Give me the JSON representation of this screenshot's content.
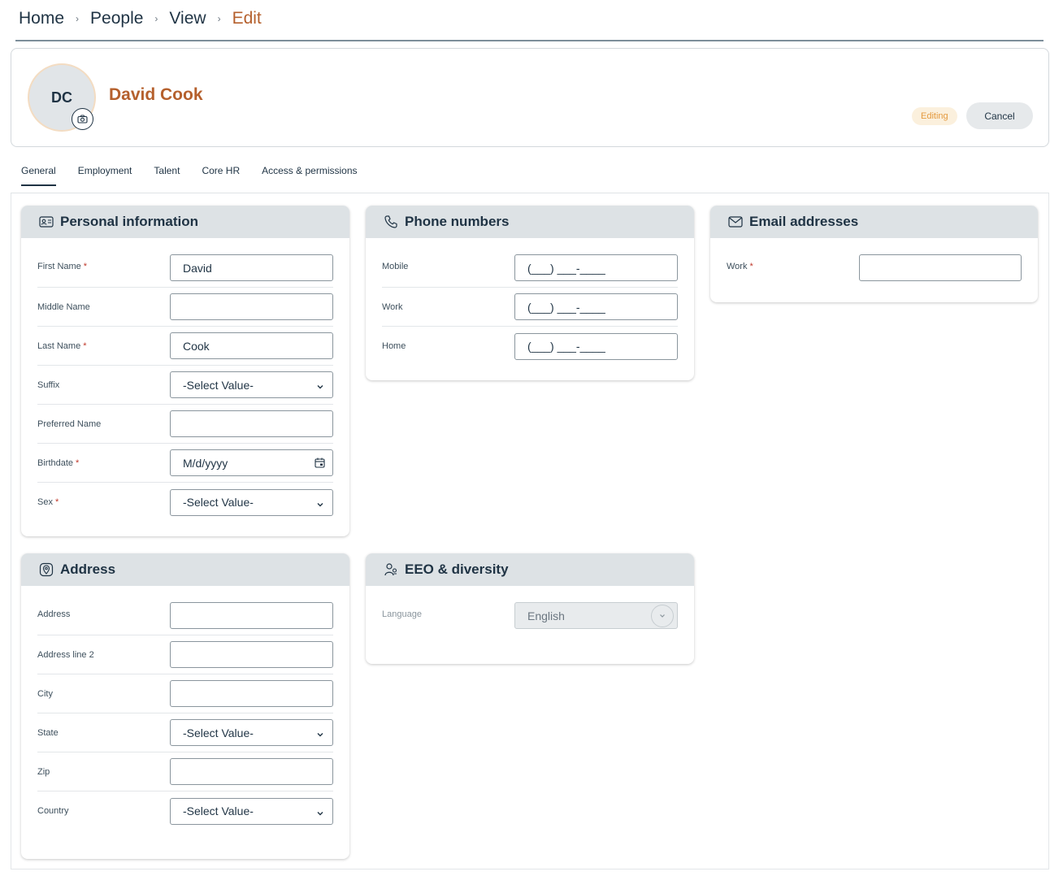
{
  "breadcrumb": {
    "items": [
      "Home",
      "People",
      "View"
    ],
    "current": "Edit",
    "separator": "›"
  },
  "profile": {
    "initials": "DC",
    "name": "David Cook",
    "status_badge": "Editing",
    "cancel_label": "Cancel"
  },
  "tabs": [
    "General",
    "Employment",
    "Talent",
    "Core HR",
    "Access & permissions"
  ],
  "active_tab": "General",
  "personal": {
    "title": "Personal information",
    "first_name": {
      "label": "First Name",
      "required": "*",
      "value": "David"
    },
    "middle_name": {
      "label": "Middle Name",
      "value": ""
    },
    "last_name": {
      "label": "Last Name",
      "required": "*",
      "value": "Cook"
    },
    "suffix": {
      "label": "Suffix",
      "value": "-Select Value-"
    },
    "preferred_name": {
      "label": "Preferred Name",
      "value": ""
    },
    "birthdate": {
      "label": "Birthdate",
      "required": "*",
      "value": "M/d/yyyy"
    },
    "sex": {
      "label": "Sex",
      "required": "*",
      "value": "-Select Value-"
    }
  },
  "phones": {
    "title": "Phone numbers",
    "mobile": {
      "label": "Mobile",
      "value": "(___) ___-____"
    },
    "work": {
      "label": "Work",
      "value": "(___) ___-____"
    },
    "home": {
      "label": "Home",
      "value": "(___) ___-____"
    }
  },
  "emails": {
    "title": "Email addresses",
    "work": {
      "label": "Work",
      "required": "*",
      "value": ""
    }
  },
  "address": {
    "title": "Address",
    "address": {
      "label": "Address",
      "value": ""
    },
    "address2": {
      "label": "Address line 2",
      "value": ""
    },
    "city": {
      "label": "City",
      "value": ""
    },
    "state": {
      "label": "State",
      "value": "-Select Value-"
    },
    "zip": {
      "label": "Zip",
      "value": ""
    },
    "country": {
      "label": "Country",
      "value": "-Select Value-"
    }
  },
  "eeo": {
    "title": "EEO & diversity",
    "language": {
      "label": "Language",
      "value": "English"
    }
  },
  "colors": {
    "accent": "#b5602d",
    "text": "#1f3344",
    "badge_text": "#e49a3f",
    "badge_bg": "#fbf0dd",
    "panel_header": "#dde2e5",
    "required": "#c0392b"
  },
  "icons": {
    "avatar_camera": "camera-icon",
    "personal": "id-card-icon",
    "phones": "phone-icon",
    "emails": "envelope-icon",
    "address": "map-pin-icon",
    "eeo": "people-icon",
    "select": "chevron-down-icon",
    "date": "calendar-icon"
  }
}
